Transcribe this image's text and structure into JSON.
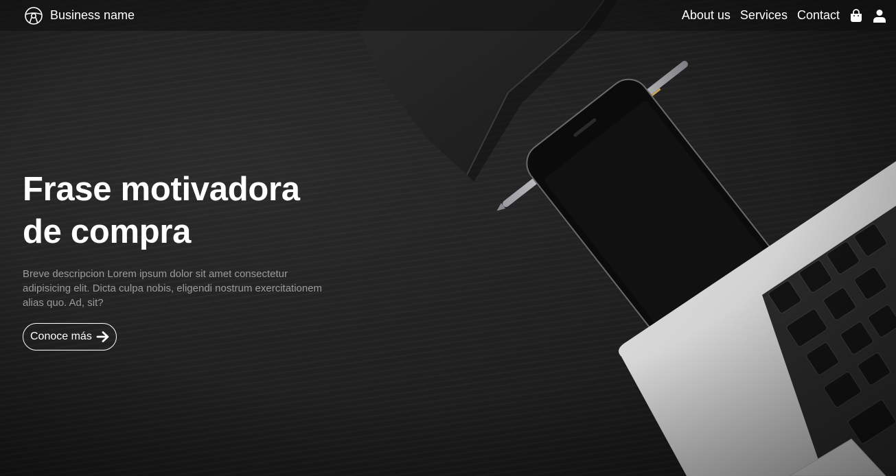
{
  "navbar": {
    "brand_icon": "steering-wheel-icon",
    "brand_name": "Business name",
    "links": [
      "About us",
      "Services",
      "Contact"
    ],
    "cart_icon": "shopping-bag-icon",
    "user_icon": "user-icon"
  },
  "hero": {
    "headline_line1": "Frase motivadora",
    "headline_line2": "de compra",
    "description": "Breve descripcion Lorem ipsum dolor sit amet consectetur adipisicing elit. Dicta culpa nobis, eligendi nostrum exercitationem alias quo. Ad, sit?",
    "cta_label": "Conoce más",
    "cta_icon": "arrow-right-icon"
  },
  "colors": {
    "background": "#1e1e1e",
    "text": "#ffffff",
    "description": "#9b9b9b"
  }
}
